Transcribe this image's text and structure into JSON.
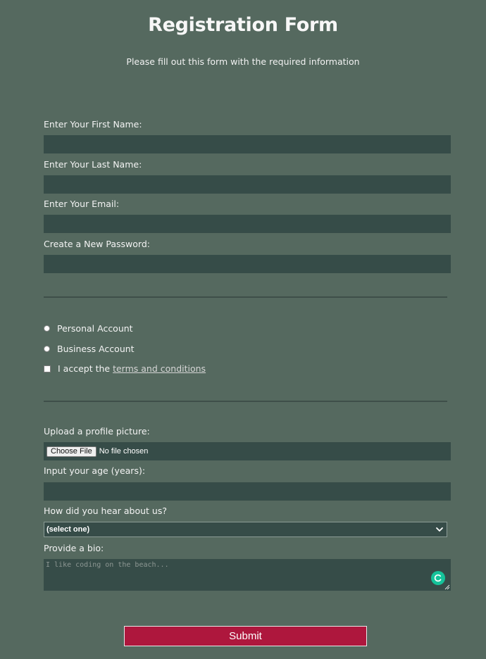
{
  "header": {
    "title": "Registration Form",
    "subtitle": "Please fill out this form with the required information"
  },
  "fields": {
    "first_name_label": "Enter Your First Name:",
    "last_name_label": "Enter Your Last Name:",
    "email_label": "Enter Your Email:",
    "password_label": "Create a New Password:"
  },
  "account": {
    "personal_label": "Personal Account",
    "business_label": "Business Account",
    "accept_prefix": "I accept the",
    "terms_link": "terms and conditions"
  },
  "upload": {
    "label": "Upload a profile picture:",
    "button_label": "Choose File",
    "status": "No file chosen"
  },
  "age": {
    "label": "Input your age (years):"
  },
  "referrer": {
    "label": "How did you hear about us?",
    "selected": "(select one)"
  },
  "bio": {
    "label": "Provide a bio:",
    "placeholder": "I like coding on the beach..."
  },
  "submit_label": "Submit",
  "colors": {
    "background": "#55695f",
    "input_background": "#364c48",
    "submit_background": "#ae173d",
    "grammar_badge": "#15c39a"
  }
}
